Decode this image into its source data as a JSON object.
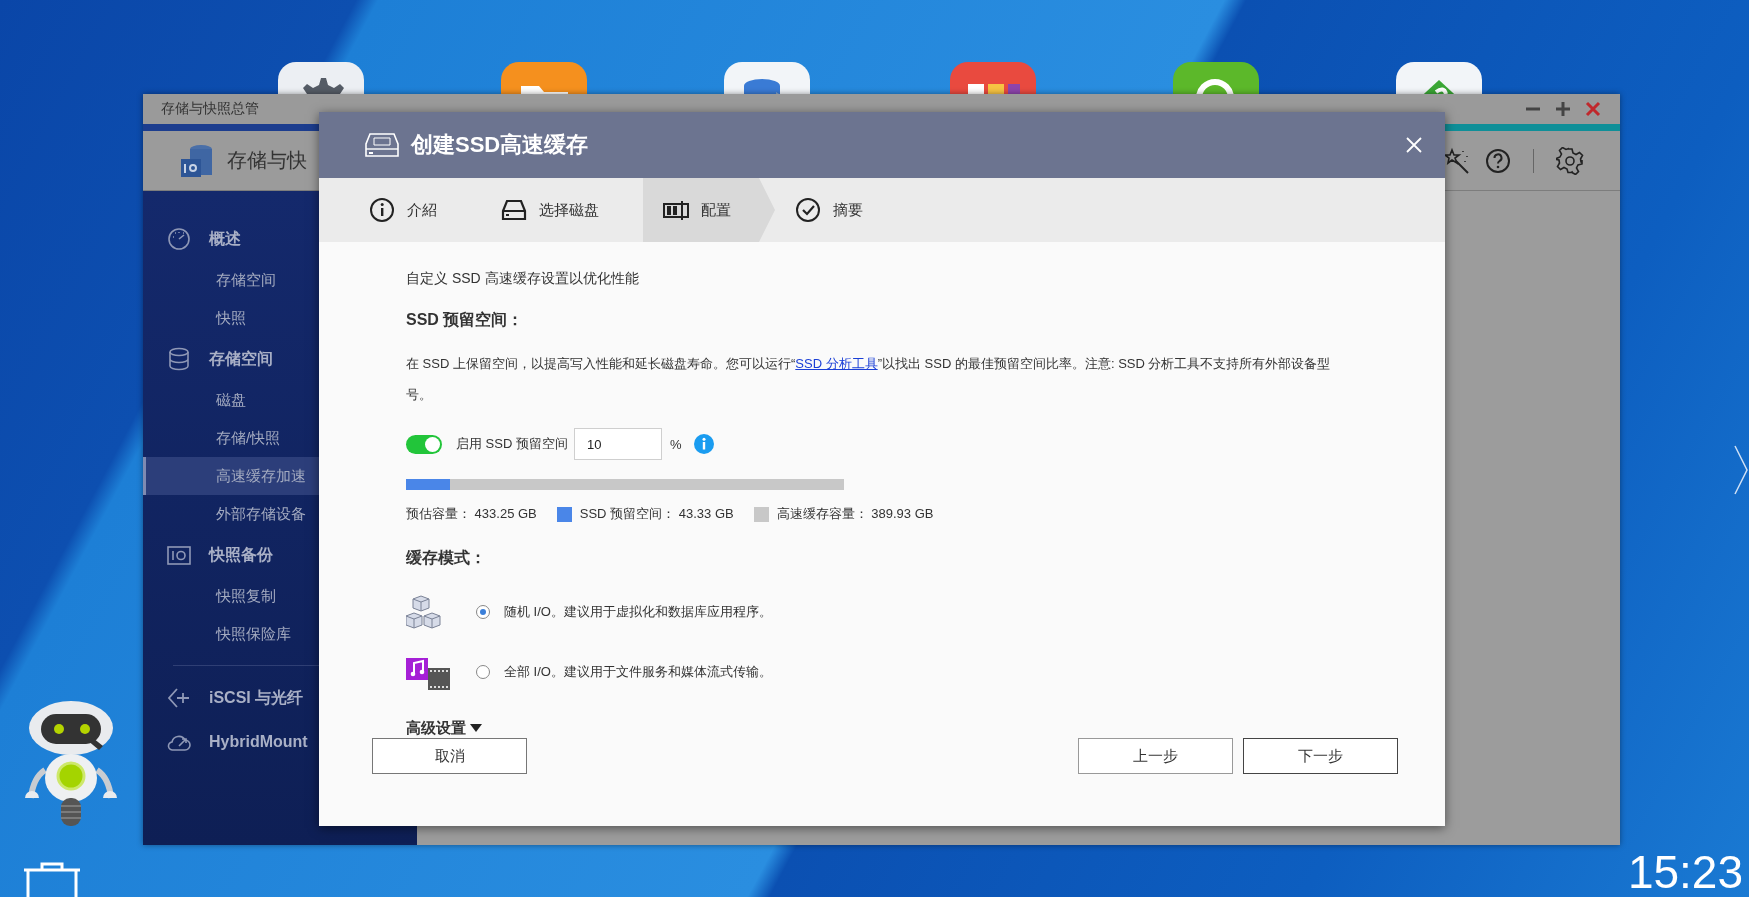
{
  "desktop": {
    "app_icons": [
      {
        "kind": "gear"
      },
      {
        "kind": "folder"
      },
      {
        "kind": "storage"
      },
      {
        "kind": "tiles"
      },
      {
        "kind": "green"
      },
      {
        "kind": "diamond"
      }
    ],
    "clock": "15:23"
  },
  "app_window": {
    "title": "存储与快照总管",
    "app_name": "存储与快",
    "sections": [
      {
        "kind": "gauge",
        "label": "概述",
        "children": [
          {
            "label": "存储空间",
            "selected": false
          },
          {
            "label": "快照",
            "selected": false
          }
        ]
      },
      {
        "kind": "database",
        "label": "存储空间",
        "children": [
          {
            "label": "磁盘",
            "selected": false
          },
          {
            "label": "存储/快照",
            "selected": false
          },
          {
            "label": "高速缓存加速",
            "selected": true
          },
          {
            "label": "外部存储设备",
            "selected": false
          }
        ]
      },
      {
        "kind": "snapshot",
        "label": "快照备份",
        "children": [
          {
            "label": "快照复制",
            "selected": false
          },
          {
            "label": "快照保险库",
            "selected": false
          }
        ]
      }
    ],
    "extra_items": [
      {
        "kind": "iscsi",
        "label": "iSCSI 与光纤"
      },
      {
        "kind": "cloud",
        "label": "HybridMount"
      }
    ]
  },
  "dialog": {
    "title": "创建SSD高速缓存",
    "steps": [
      {
        "kind": "info",
        "label": "介紹",
        "selected": false
      },
      {
        "kind": "disk",
        "label": "选择磁盘",
        "selected": false
      },
      {
        "kind": "config",
        "label": "配置",
        "selected": true
      },
      {
        "kind": "check",
        "label": "摘要",
        "selected": false
      }
    ],
    "intro": "自定义 SSD 高速缓存设置以优化性能",
    "reserve_heading": "SSD 预留空间：",
    "description": {
      "before": "在 SSD 上保留空间，以提高写入性能和延长磁盘寿命。您可以运行“",
      "link": "SSD 分析工具",
      "after": "”以找出 SSD 的最佳预留空间比率。注意: SSD 分析工具不支持所有外部设备型号。"
    },
    "reserve_toggle": {
      "label": "启用 SSD 预留空间",
      "on": true,
      "value": "10",
      "unit": "%"
    },
    "usage_bar": {
      "level": 0.1
    },
    "legend": [
      {
        "label": "预估容量： 433.25 GB"
      },
      {
        "label": "SSD 预留空间： 43.33 GB",
        "color": "#4a86e8"
      },
      {
        "label": "高速缓存容量： 389.93 GB",
        "color": "#c8c8c8"
      }
    ],
    "cache_mode_heading": "缓存模式：",
    "cache_modes": [
      {
        "kind": "random",
        "label": "随机 I/O。建议用于虚拟化和数据库应用程序。",
        "selected": true
      },
      {
        "kind": "all",
        "label": "全部 I/O。建议用于文件服务和媒体流式传输。",
        "selected": false
      }
    ],
    "advanced": "高级设置",
    "buttons": {
      "cancel": "取消",
      "back": "上一步",
      "next": "下一步"
    }
  }
}
